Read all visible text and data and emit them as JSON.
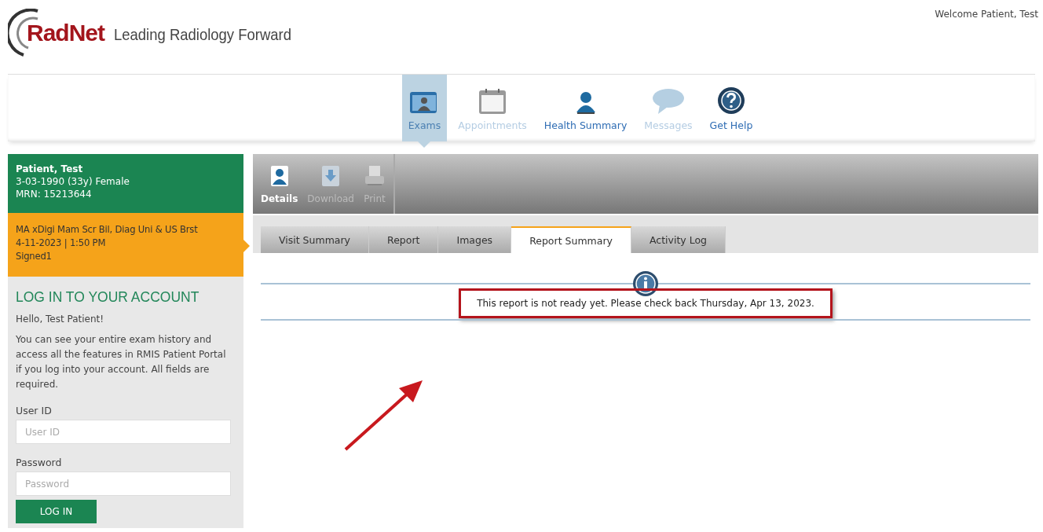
{
  "header": {
    "logo_brand": "RadNet",
    "logo_tagline": "Leading Radiology Forward",
    "welcome": "Welcome Patient, Test"
  },
  "nav": [
    {
      "label": "Exams",
      "kind": "exams",
      "selected": true,
      "disabled": false
    },
    {
      "label": "Appointments",
      "kind": "calendar",
      "selected": false,
      "disabled": true
    },
    {
      "label": "Health Summary",
      "kind": "person",
      "selected": false,
      "disabled": false
    },
    {
      "label": "Messages",
      "kind": "messages",
      "selected": false,
      "disabled": true
    },
    {
      "label": "Get Help",
      "kind": "help",
      "selected": false,
      "disabled": false
    }
  ],
  "patient": {
    "name": "Patient, Test",
    "dob": "3-03-1990 (33y) Female",
    "mrn": "MRN: 15213644"
  },
  "exam": {
    "name": "MA xDigi Mam Scr Bil, Diag Uni & US Brst",
    "datetime": "4-11-2023 | 1:50 PM",
    "status": "Signed1"
  },
  "login": {
    "title": "LOG IN TO YOUR ACCOUNT",
    "greeting": "Hello, Test Patient!",
    "description": "You can see your entire exam history and access all the features in RMIS Patient Portal if you log into your account. All fields are required.",
    "fields": [
      {
        "label": "User ID",
        "placeholder": "User ID"
      },
      {
        "label": "Password",
        "placeholder": "Password"
      }
    ],
    "button": "LOG IN"
  },
  "toolbar": [
    {
      "label": "Details",
      "kind": "details",
      "disabled": false
    },
    {
      "label": "Download",
      "kind": "download",
      "disabled": true
    },
    {
      "label": "Print",
      "kind": "print",
      "disabled": true
    }
  ],
  "tabs": [
    {
      "label": "Visit Summary",
      "selected": false
    },
    {
      "label": "Report",
      "selected": false
    },
    {
      "label": "Images",
      "selected": false
    },
    {
      "label": "Report Summary",
      "selected": true
    },
    {
      "label": "Activity Log",
      "selected": false
    }
  ],
  "message": {
    "text": "This report is not ready yet. Please check back Thursday, Apr 13, 2023.",
    "highlighted": true
  }
}
